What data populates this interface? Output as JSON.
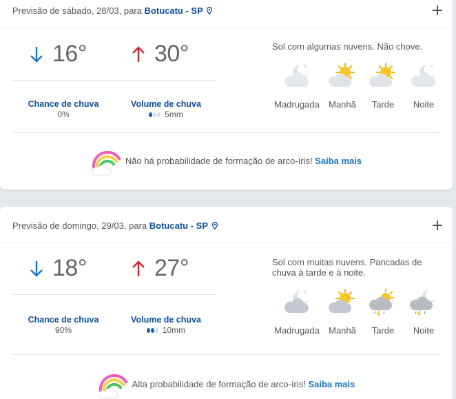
{
  "days": [
    {
      "header_prefix": "Previsão de sábado, 28/03, para",
      "city": "Botucatu - SP",
      "min_temp": "16°",
      "max_temp": "30°",
      "rain_chance_label": "Chance de chuva",
      "rain_chance": "0%",
      "rain_volume_label": "Volume de chuva",
      "rain_volume": "5mm",
      "rain_volume_level": 1,
      "description": "Sol com algumas nuvens. Não chove.",
      "periods": [
        {
          "name": "Madrugada",
          "icon": "moon-cloud-icon"
        },
        {
          "name": "Manhã",
          "icon": "sun-cloud-icon"
        },
        {
          "name": "Tarde",
          "icon": "sun-cloud-icon"
        },
        {
          "name": "Noite",
          "icon": "moon-cloud-icon"
        }
      ],
      "rainbow_text": "Não há probabilidade de formação de arco-íris!",
      "rainbow_link": "Saiba mais"
    },
    {
      "header_prefix": "Previsão de domingo, 29/03, para",
      "city": "Botucatu - SP",
      "min_temp": "18°",
      "max_temp": "27°",
      "rain_chance_label": "Chance de chuva",
      "rain_chance": "90%",
      "rain_volume_label": "Volume de chuva",
      "rain_volume": "10mm",
      "rain_volume_level": 2,
      "description": "Sol com muitas nuvens. Pancadas de chuva à tarde e à noite.",
      "periods": [
        {
          "name": "Madrugada",
          "icon": "moon-cloud-icon"
        },
        {
          "name": "Manhã",
          "icon": "sun-cloud-icon"
        },
        {
          "name": "Tarde",
          "icon": "sun-storm-icon"
        },
        {
          "name": "Noite",
          "icon": "moon-storm-icon"
        }
      ],
      "rainbow_text": "Alta probabilidade de formação de arco-íris!",
      "rainbow_link": "Saiba mais"
    }
  ],
  "colors": {
    "link": "#0d4fa0",
    "min_arrow": "#1a73c7",
    "max_arrow": "#d0202a",
    "drop_active": "#1a5fb4",
    "drop_inactive": "#d6dce4"
  }
}
